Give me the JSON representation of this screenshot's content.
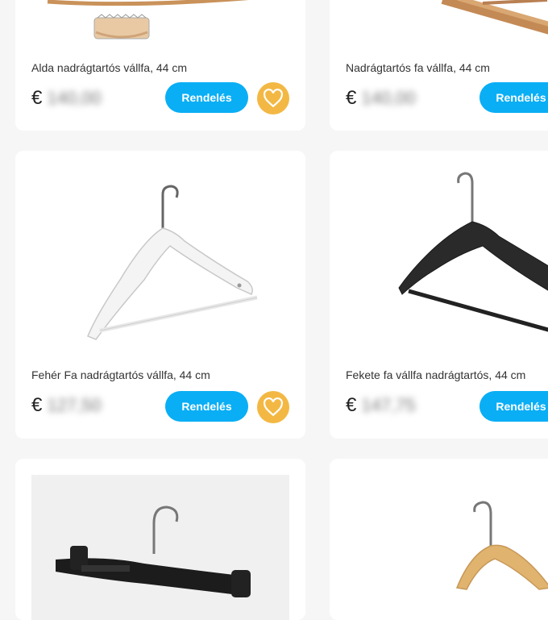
{
  "currency": "€",
  "order_label": "Rendelés",
  "products": [
    {
      "title": "Alda nadrágtartós vállfa, 44 cm",
      "price": "140,00"
    },
    {
      "title": "Nadrágtartós fa vállfa, 44 cm",
      "price": "140,00"
    },
    {
      "title": "Fehér Fa nadrágtartós vállfa, 44 cm",
      "price": "127,50"
    },
    {
      "title": "Fekete fa vállfa nadrágtartós, 44 cm",
      "price": "147,75"
    }
  ],
  "colors": {
    "accent": "#0aaef5",
    "favorite": "#f3b844",
    "background": "#f6f6f6"
  }
}
